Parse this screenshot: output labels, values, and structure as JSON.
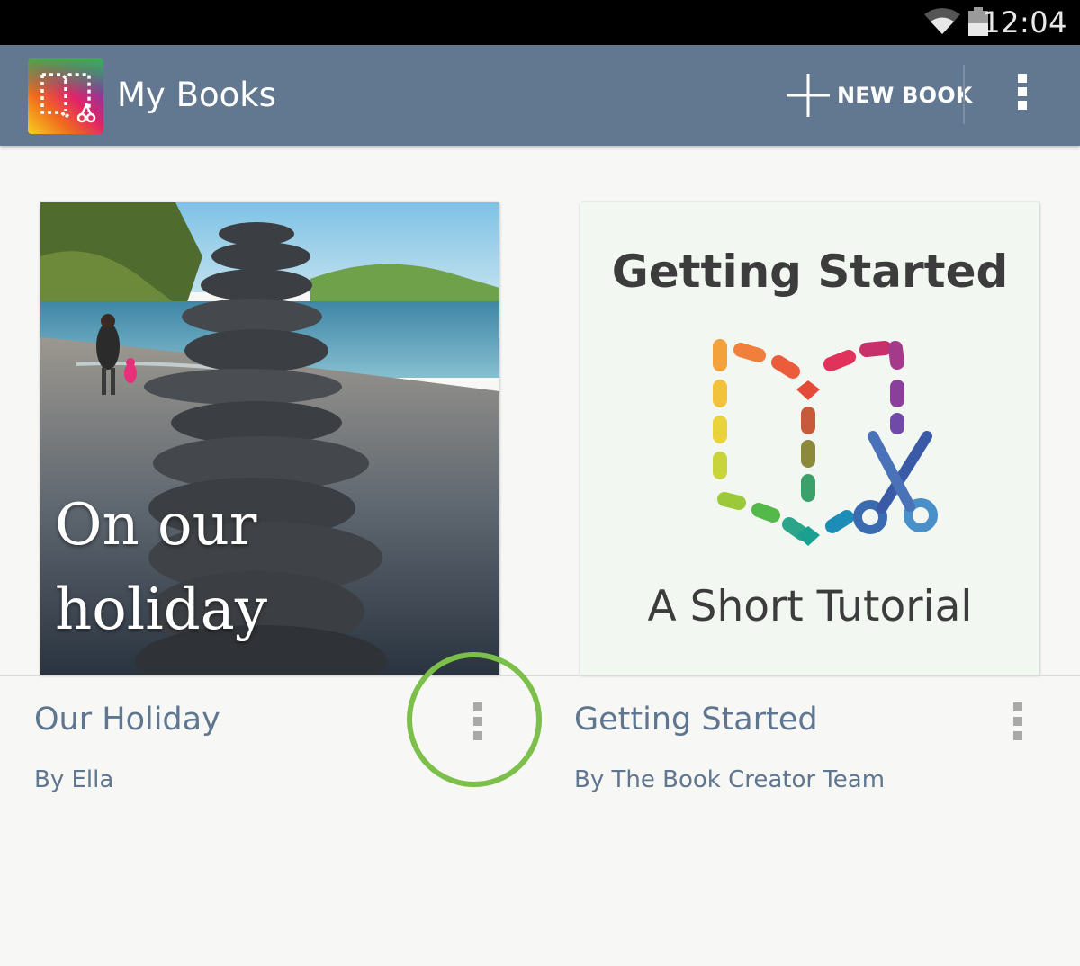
{
  "status_bar": {
    "time": "12:04",
    "icons": [
      "wifi-icon",
      "battery-icon"
    ]
  },
  "app_bar": {
    "title": "My Books",
    "new_book_label": "NEW BOOK",
    "icons": [
      "app-logo",
      "plus-icon",
      "overflow-menu-icon"
    ],
    "color": "#627890"
  },
  "books": [
    {
      "title": "Our Holiday",
      "author": "By Ella",
      "cover_text_line1": "On our",
      "cover_text_line2": "holiday"
    },
    {
      "title": "Getting Started",
      "author": "By The Book Creator Team",
      "cover_title": "Getting Started",
      "cover_subtitle": "A Short Tutorial"
    }
  ],
  "colors": {
    "highlight_ring": "#7cbf4a",
    "shelf_text": "#5f7690",
    "background": "#f7f7f5"
  }
}
